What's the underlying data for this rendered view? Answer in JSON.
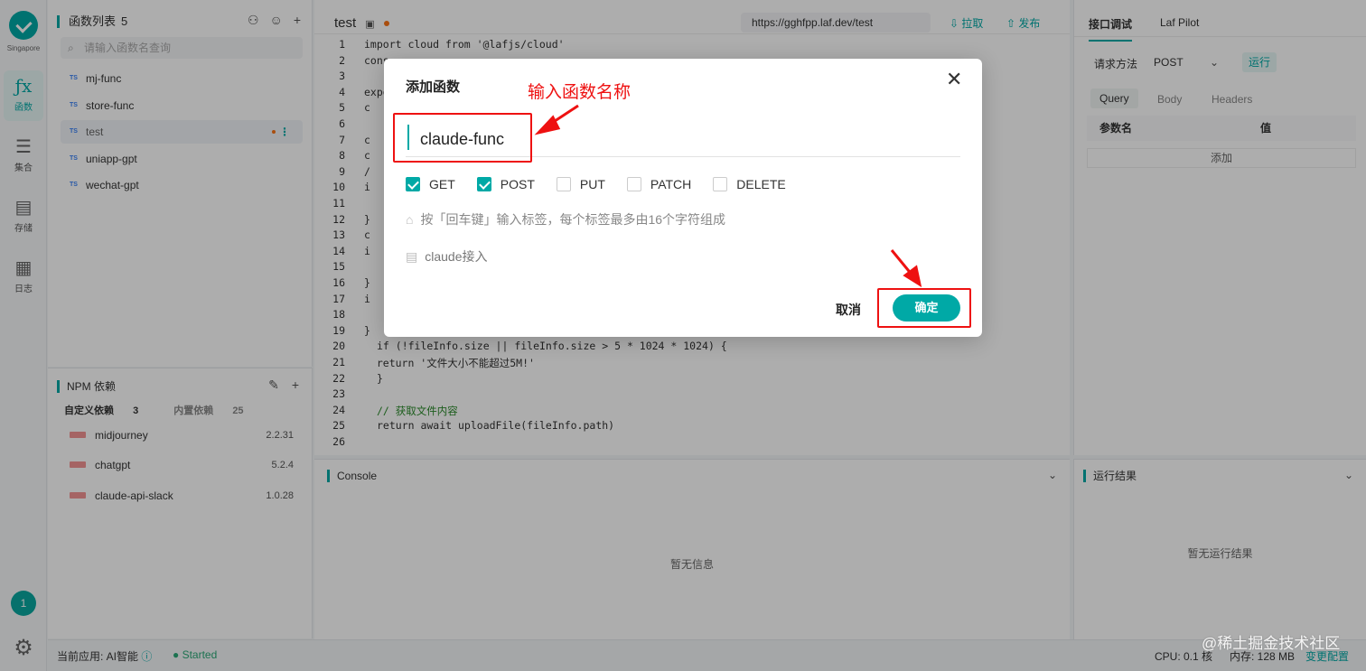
{
  "rail": {
    "region": "Singapore",
    "items": [
      {
        "label": "函数",
        "icon": "fx-icon",
        "glyph": "ƒx"
      },
      {
        "label": "集合",
        "icon": "database-icon",
        "glyph": "☰"
      },
      {
        "label": "存储",
        "icon": "storage-icon",
        "glyph": "▤"
      },
      {
        "label": "日志",
        "icon": "log-icon",
        "glyph": "▦"
      }
    ],
    "avatar": "1"
  },
  "function_list": {
    "title": "函数列表",
    "count": "5",
    "search_placeholder": "请输入函数名查询",
    "items": [
      "mj-func",
      "store-func",
      "test",
      "uniapp-gpt",
      "wechat-gpt"
    ],
    "ts_badge": "TS"
  },
  "npm": {
    "title": "NPM 依赖",
    "tab_custom": "自定义依赖",
    "tab_custom_count": "3",
    "tab_builtin": "内置依赖",
    "tab_builtin_count": "25",
    "packages": [
      {
        "name": "midjourney",
        "version": "2.2.31"
      },
      {
        "name": "chatgpt",
        "version": "5.2.4"
      },
      {
        "name": "claude-api-slack",
        "version": "1.0.28"
      }
    ]
  },
  "editor": {
    "tab": "test",
    "url": "https://gghfpp.laf.dev/test",
    "pull": "拉取",
    "publish": "发布",
    "line_numbers": [
      "1",
      "2",
      "3",
      "4",
      "5",
      "6",
      "7",
      "8",
      "9",
      "10",
      "11",
      "12",
      "13",
      "14",
      "15",
      "16",
      "17",
      "18",
      "19",
      "20",
      "21",
      "22",
      "23",
      "24",
      "25",
      "26"
    ],
    "code_visible": {
      "l1": "import cloud from '@lafjs/cloud'",
      "l2": "cons",
      "l4": "expo",
      "l5": "c",
      "l7": "c",
      "l8": "c",
      "l9": "/",
      "l10": "i",
      "l12": "}",
      "l13": "c",
      "l14": "i",
      "l16": "}",
      "l17": "i",
      "l19": "}",
      "l20": "if (!fileInfo.size || fileInfo.size > 5 * 1024 * 1024) {",
      "l21": "  return '文件大小不能超过5M!'",
      "l22": "}",
      "l24": "// 获取文件内容",
      "l25": "return await uploadFile(fileInfo.path)"
    }
  },
  "console": {
    "title": "Console",
    "empty": "暂无信息"
  },
  "right_panel": {
    "tab_debug": "接口调试",
    "tab_pilot": "Laf Pilot",
    "method_label": "请求方法",
    "method": "POST",
    "run": "运行",
    "subtabs": [
      "Query",
      "Body",
      "Headers"
    ],
    "param_name": "参数名",
    "param_value": "值",
    "add": "添加",
    "result_title": "运行结果",
    "result_empty": "暂无运行结果"
  },
  "status_bar": {
    "app": "当前应用: AI智能",
    "state": "Started",
    "cpu": "CPU: 0.1 核",
    "mem": "内存: 128 MB",
    "change": "变更配置"
  },
  "watermark": "@稀土掘金技术社区",
  "modal": {
    "title": "添加函数",
    "annotation": "输入函数名称",
    "name_value": "claude-func",
    "methods": [
      {
        "label": "GET",
        "checked": true
      },
      {
        "label": "POST",
        "checked": true
      },
      {
        "label": "PUT",
        "checked": false
      },
      {
        "label": "PATCH",
        "checked": false
      },
      {
        "label": "DELETE",
        "checked": false
      }
    ],
    "tags_placeholder": "按「回车键」输入标签，每个标签最多由16个字符组成",
    "description": "claude接入",
    "cancel": "取消",
    "confirm": "确定",
    "annotation_color": "#e11111",
    "accent_color": "#00a9a6"
  }
}
